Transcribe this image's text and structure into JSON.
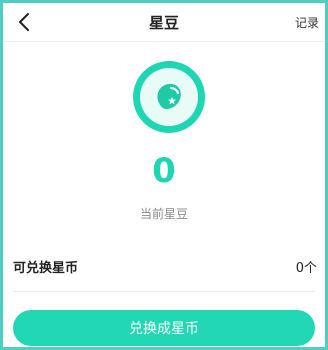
{
  "header": {
    "title": "星豆",
    "record_label": "记录"
  },
  "balance": {
    "amount": "0",
    "label": "当前星豆"
  },
  "exchange": {
    "label": "可兑换星币",
    "value": "0个"
  },
  "action": {
    "button_label": "兑换成星币"
  },
  "icons": {
    "back": "chevron-left-icon",
    "bean": "star-bean-icon"
  },
  "colors": {
    "accent": "#22d7b4",
    "frame": "#4fcfc0",
    "icon_bg": "#e9fbf7",
    "text_primary": "#222222",
    "text_secondary": "#8a8a8a"
  }
}
